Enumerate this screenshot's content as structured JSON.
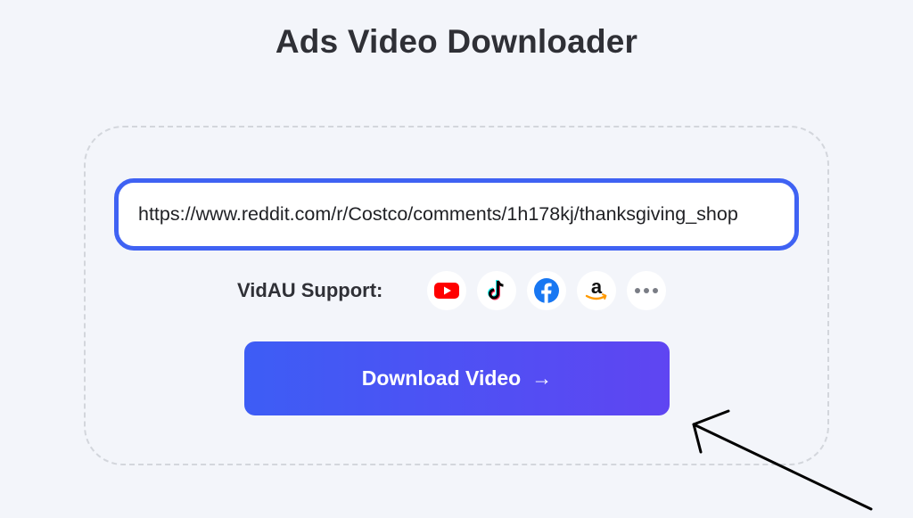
{
  "page": {
    "title": "Ads Video Downloader"
  },
  "url_input": {
    "value": "https://www.reddit.com/r/Costco/comments/1h178kj/thanksgiving_shop"
  },
  "support": {
    "label": "VidAU Support:",
    "platforms": [
      {
        "icon": "youtube-icon",
        "color": "#ff0000"
      },
      {
        "icon": "tiktok-icon",
        "color": "#000000"
      },
      {
        "icon": "facebook-icon",
        "color": "#1877f2"
      },
      {
        "icon": "amazon-icon",
        "color": "#ff9900"
      },
      {
        "icon": "more-icon",
        "color": "#7a7d85"
      }
    ]
  },
  "download_button": {
    "label": "Download Video",
    "arrow": "→"
  },
  "colors": {
    "accent": "#3f62f3",
    "button_gradient_start": "#3d5df5",
    "button_gradient_end": "#5f45f2",
    "background": "#f3f5fa"
  }
}
